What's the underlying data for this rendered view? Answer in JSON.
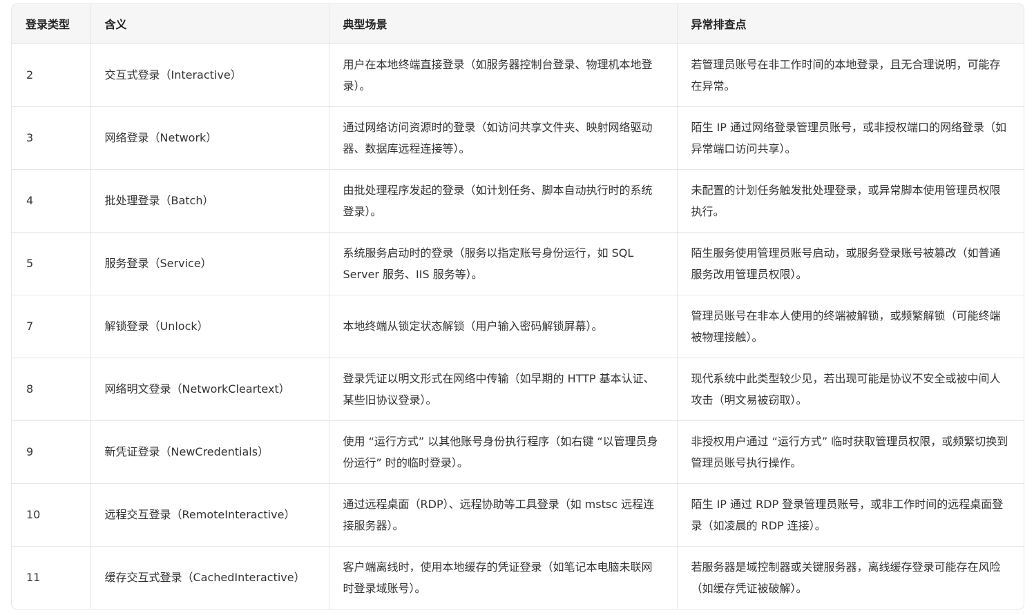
{
  "table": {
    "headers": [
      "登录类型",
      "含义",
      "典型场景",
      "异常排查点"
    ],
    "rows": [
      {
        "type": "2",
        "meaning": "交互式登录（Interactive）",
        "scenario": "用户在本地终端直接登录（如服务器控制台登录、物理机本地登录）。",
        "check": "若管理员账号在非工作时间的本地登录，且无合理说明，可能存在异常。"
      },
      {
        "type": "3",
        "meaning": "网络登录（Network）",
        "scenario": "通过网络访问资源时的登录（如访问共享文件夹、映射网络驱动器、数据库远程连接等）。",
        "check": "陌生 IP 通过网络登录管理员账号，或非授权端口的网络登录（如异常端口访问共享）。"
      },
      {
        "type": "4",
        "meaning": "批处理登录（Batch）",
        "scenario": "由批处理程序发起的登录（如计划任务、脚本自动执行时的系统登录）。",
        "check": "未配置的计划任务触发批处理登录，或异常脚本使用管理员权限执行。"
      },
      {
        "type": "5",
        "meaning": "服务登录（Service）",
        "scenario": "系统服务启动时的登录（服务以指定账号身份运行，如 SQL Server 服务、IIS 服务等）。",
        "check": "陌生服务使用管理员账号启动，或服务登录账号被篡改（如普通服务改用管理员权限）。"
      },
      {
        "type": "7",
        "meaning": "解锁登录（Unlock）",
        "scenario": "本地终端从锁定状态解锁（用户输入密码解锁屏幕）。",
        "check": "管理员账号在非本人使用的终端被解锁，或频繁解锁（可能终端被物理接触）。"
      },
      {
        "type": "8",
        "meaning": "网络明文登录（NetworkCleartext）",
        "scenario": "登录凭证以明文形式在网络中传输（如早期的 HTTP 基本认证、某些旧协议登录）。",
        "check": "现代系统中此类型较少见，若出现可能是协议不安全或被中间人攻击（明文易被窃取）。"
      },
      {
        "type": "9",
        "meaning": "新凭证登录（NewCredentials）",
        "scenario": "使用 “运行方式” 以其他账号身份执行程序（如右键 “以管理员身份运行” 时的临时登录）。",
        "check": "非授权用户通过 “运行方式” 临时获取管理员权限，或频繁切换到管理员账号执行操作。"
      },
      {
        "type": "10",
        "meaning": "远程交互登录（RemoteInteractive）",
        "scenario": "通过远程桌面（RDP）、远程协助等工具登录（如 mstsc 远程连接服务器）。",
        "check": "陌生 IP 通过 RDP 登录管理员账号，或非工作时间的远程桌面登录（如凌晨的 RDP 连接）。"
      },
      {
        "type": "11",
        "meaning": "缓存交互式登录（CachedInteractive）",
        "scenario": "客户端离线时，使用本地缓存的凭证登录（如笔记本电脑未联网时登录域账号）。",
        "check": "若服务器是域控制器或关键服务器，离线缓存登录可能存在风险（如缓存凭证被破解）。"
      }
    ]
  }
}
